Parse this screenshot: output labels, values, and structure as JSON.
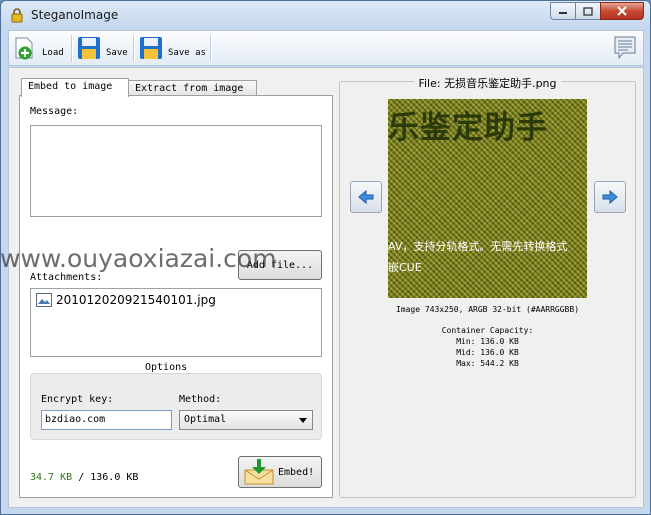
{
  "window": {
    "title": "SteganoImage",
    "controls": [
      "minimize",
      "maximize",
      "close"
    ]
  },
  "toolbar": {
    "load_label": "Load",
    "save_label": "Save",
    "save_as_label": "Save as",
    "right_icon": "notes-icon"
  },
  "tabs": [
    {
      "label": "Embed to image",
      "active": true
    },
    {
      "label": "Extract from image",
      "active": false
    }
  ],
  "embed": {
    "message_label": "Message:",
    "message_value": "",
    "add_file_label": "Add file...",
    "attachments_label": "Attachments:",
    "attachments": [
      {
        "name": "201012020921540101.jpg",
        "icon": "image-file-icon"
      }
    ],
    "options_title": "Options",
    "encrypt_key_label": "Encrypt key:",
    "encrypt_key_value": "bzdiao.com",
    "method_label": "Method:",
    "method_value": "Optimal",
    "size_used": "34.7 KB",
    "size_separator": "/",
    "size_total": "136.0 KB",
    "embed_label": "Embed!"
  },
  "preview": {
    "file_title": "File: 无损音乐鉴定助手.png",
    "image_text_title": "乐鉴定助手",
    "image_text_line1": "AV，支持分轨格式。无需先转换格式",
    "image_text_line2": "嵌CUE",
    "image_info": "Image 743x250, ARGB 32-bit (#AARRGGBB)",
    "capacity_title": "Container Capacity:",
    "capacity_min": "Min: 136.0 KB",
    "capacity_mid": "Mid: 136.0 KB",
    "capacity_max": "Max: 544.2 KB"
  },
  "watermark": "www.ouyaoxiazai.com",
  "colors": {
    "size_used": "#2a7a14",
    "titlebar": "#c4d7ee",
    "preview_bg": "#7a7e1c"
  }
}
